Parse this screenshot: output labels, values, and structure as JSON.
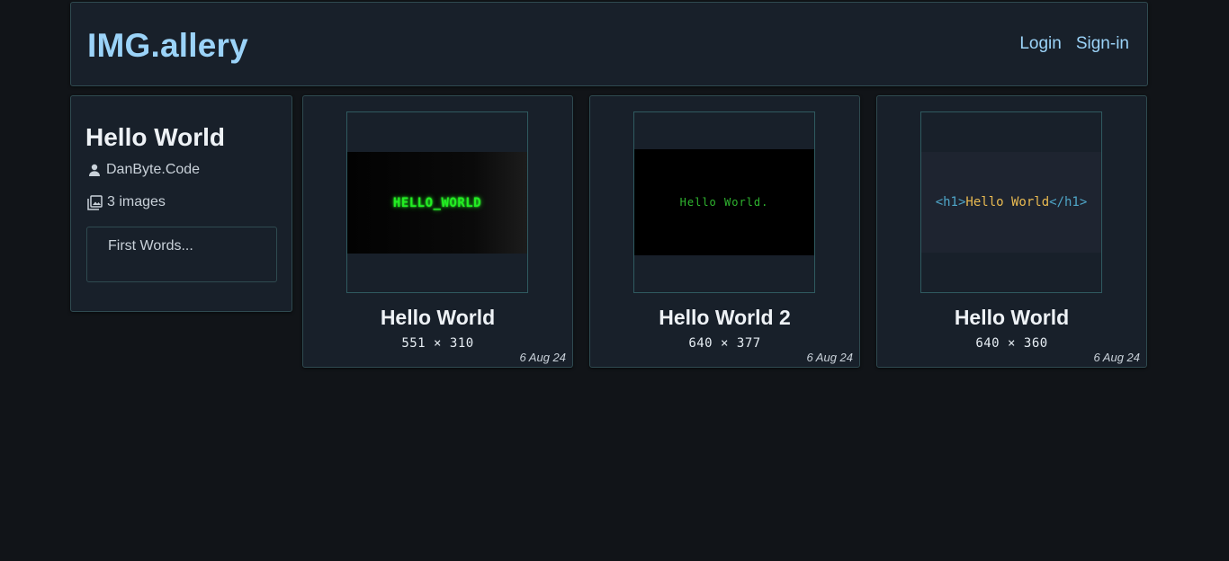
{
  "header": {
    "logo": "IMG.allery",
    "nav": {
      "login": "Login",
      "signin": "Sign-in"
    }
  },
  "album": {
    "title": "Hello World",
    "author": "DanByte.Code",
    "image_count": "3 images",
    "description": "First Words...",
    "icons": {
      "author": "person-icon",
      "count": "images-icon"
    }
  },
  "images": [
    {
      "title": "Hello World",
      "dimensions": "551 × 310",
      "date": "6 Aug 24",
      "thumb_text": "HELLO_WORLD"
    },
    {
      "title": "Hello World 2",
      "dimensions": "640 × 377",
      "date": "6 Aug 24",
      "thumb_text": "Hello World."
    },
    {
      "title": "Hello World",
      "dimensions": "640 × 360",
      "date": "6 Aug 24",
      "thumb_tag_open": "<h1>",
      "thumb_text": "Hello World",
      "thumb_tag_close": "</h1>"
    }
  ],
  "colors": {
    "background": "#111418",
    "panel": "#18202a",
    "border": "#2f4a50",
    "accent": "#9bd3f8"
  }
}
